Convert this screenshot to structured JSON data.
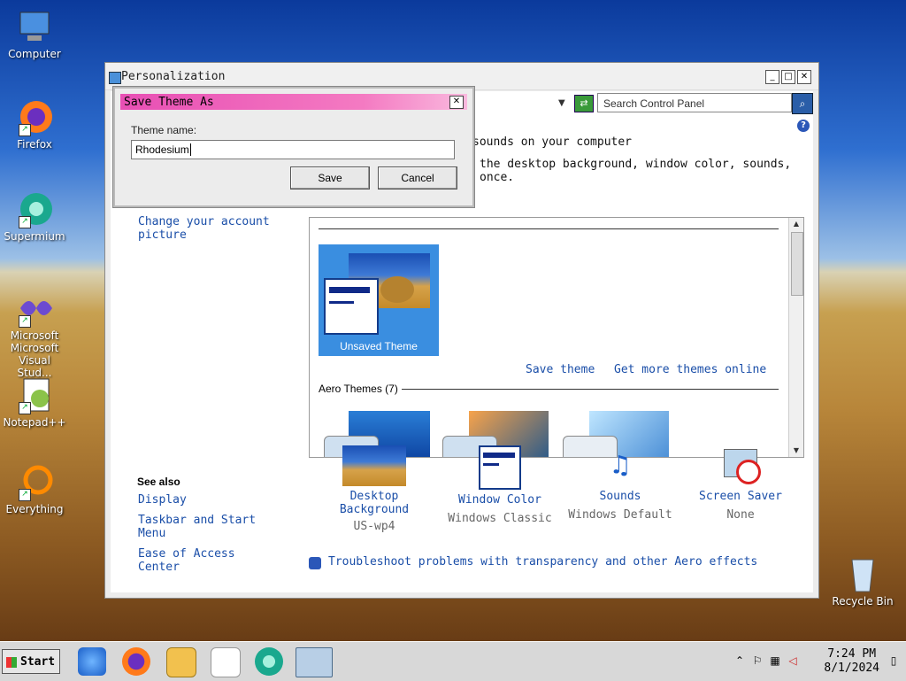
{
  "desktop": {
    "icons": [
      {
        "label": "Computer",
        "icon": "computer-icon"
      },
      {
        "label": "Firefox",
        "icon": "firefox-icon"
      },
      {
        "label": "Supermium",
        "icon": "supermium-icon"
      },
      {
        "label": "Microsoft Visual Stud...",
        "icon": "visual-studio-icon"
      },
      {
        "label": "Notepad++",
        "icon": "notepad-plus-plus-icon"
      },
      {
        "label": "Everything",
        "icon": "everything-icon"
      },
      {
        "label": "Recycle Bin",
        "icon": "recycle-bin-icon"
      }
    ]
  },
  "window": {
    "title": "Personalization",
    "search_placeholder": "Search Control Panel",
    "heading1": "sounds on your computer",
    "heading2a": "the desktop background, window color, sounds,",
    "heading2b": "once.",
    "sidebar_link": "Change your account picture",
    "unsaved_theme": "Unsaved Theme",
    "save_theme": "Save theme",
    "get_more": "Get more themes online",
    "aero_label": "Aero Themes (7)",
    "see_also": "See also",
    "see_also_links": [
      "Display",
      "Taskbar and Start Menu",
      "Ease of Access Center"
    ],
    "bottom": [
      {
        "title": "Desktop Background",
        "sub": "US-wp4"
      },
      {
        "title": "Window Color",
        "sub": "Windows Classic"
      },
      {
        "title": "Sounds",
        "sub": "Windows Default"
      },
      {
        "title": "Screen Saver",
        "sub": "None"
      }
    ],
    "troubleshoot": "Troubleshoot problems with transparency and other Aero effects"
  },
  "dialog": {
    "title": "Save Theme As",
    "label": "Theme name:",
    "value": "Rhodesium",
    "save": "Save",
    "cancel": "Cancel"
  },
  "taskbar": {
    "start": "Start",
    "time": "7:24 PM",
    "date": "8/1/2024"
  }
}
